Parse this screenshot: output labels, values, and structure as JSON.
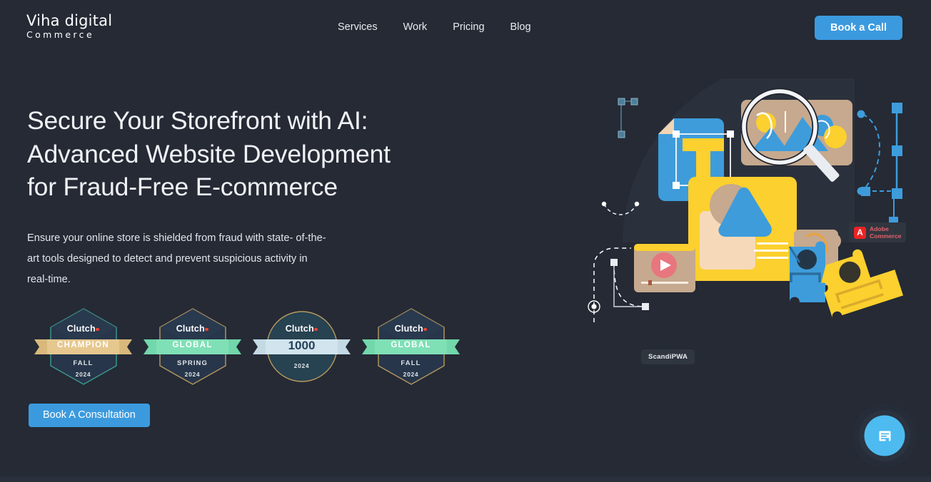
{
  "brand": {
    "logo_line1": "Viha digital",
    "logo_line2": "Commerce"
  },
  "header": {
    "nav_items": [
      {
        "label": "Services"
      },
      {
        "label": "Work"
      },
      {
        "label": "Pricing"
      },
      {
        "label": "Blog"
      }
    ],
    "cta_label": "Book a Call",
    "cta_color": "#3b9ade"
  },
  "hero": {
    "title": "Secure Your Storefront with AI: Advanced Website Development for Fraud-Free E-commerce",
    "title_line1": "Secure Your Storefront with AI:",
    "title_line2": "Advanced Website Development",
    "title_line3": "for Fraud-Free E-commerce",
    "subtitle": "Ensure your online store is shielded from fraud with state- of-the-art tools designed to detect and prevent suspicious activity in real-time.",
    "cta_label": "Book A Consultation",
    "cta_color": "#3b9ade",
    "background_color": "#252a35",
    "text_color": "#f0f2f5"
  },
  "badges": [
    {
      "brand": "Clutch",
      "award": "CHAMPION",
      "season": "FALL",
      "year": "2024",
      "shape": "hexagon",
      "ribbon_color": "#d9b87c",
      "ribbon_text_color": "#ffffff",
      "border_color": "#3e9c8d"
    },
    {
      "brand": "Clutch",
      "award": "GLOBAL",
      "season": "SPRING",
      "year": "2024",
      "shape": "hexagon",
      "ribbon_color": "#72d7ab",
      "ribbon_text_color": "#ffffff",
      "border_color": "#b99a5f"
    },
    {
      "brand": "Clutch",
      "award": "1000",
      "season": "",
      "year": "2024",
      "shape": "circle",
      "ribbon_color": "#c3dae4",
      "ribbon_text_color": "#27415a",
      "border_color": "#b99a5f"
    },
    {
      "brand": "Clutch",
      "award": "GLOBAL",
      "season": "FALL",
      "year": "2024",
      "shape": "hexagon",
      "ribbon_color": "#72d7ab",
      "ribbon_text_color": "#ffffff",
      "border_color": "#b99a5f"
    }
  ],
  "illustration": {
    "tags": [
      {
        "name": "adobe-commerce",
        "text": "Adobe\nCommerce",
        "mark": "A",
        "mark_color": "#ec2324"
      },
      {
        "name": "scandipwa",
        "text": "ScandiPWA"
      }
    ],
    "colors": {
      "blue": "#3e9cdb",
      "yellow": "#fcd02e",
      "tan": "#c6a98e",
      "peach": "#f6d9b9",
      "play_button": "#e8767e"
    }
  },
  "chat_widget": {
    "icon": "chat-document-icon",
    "color": "#4dbbf0"
  }
}
